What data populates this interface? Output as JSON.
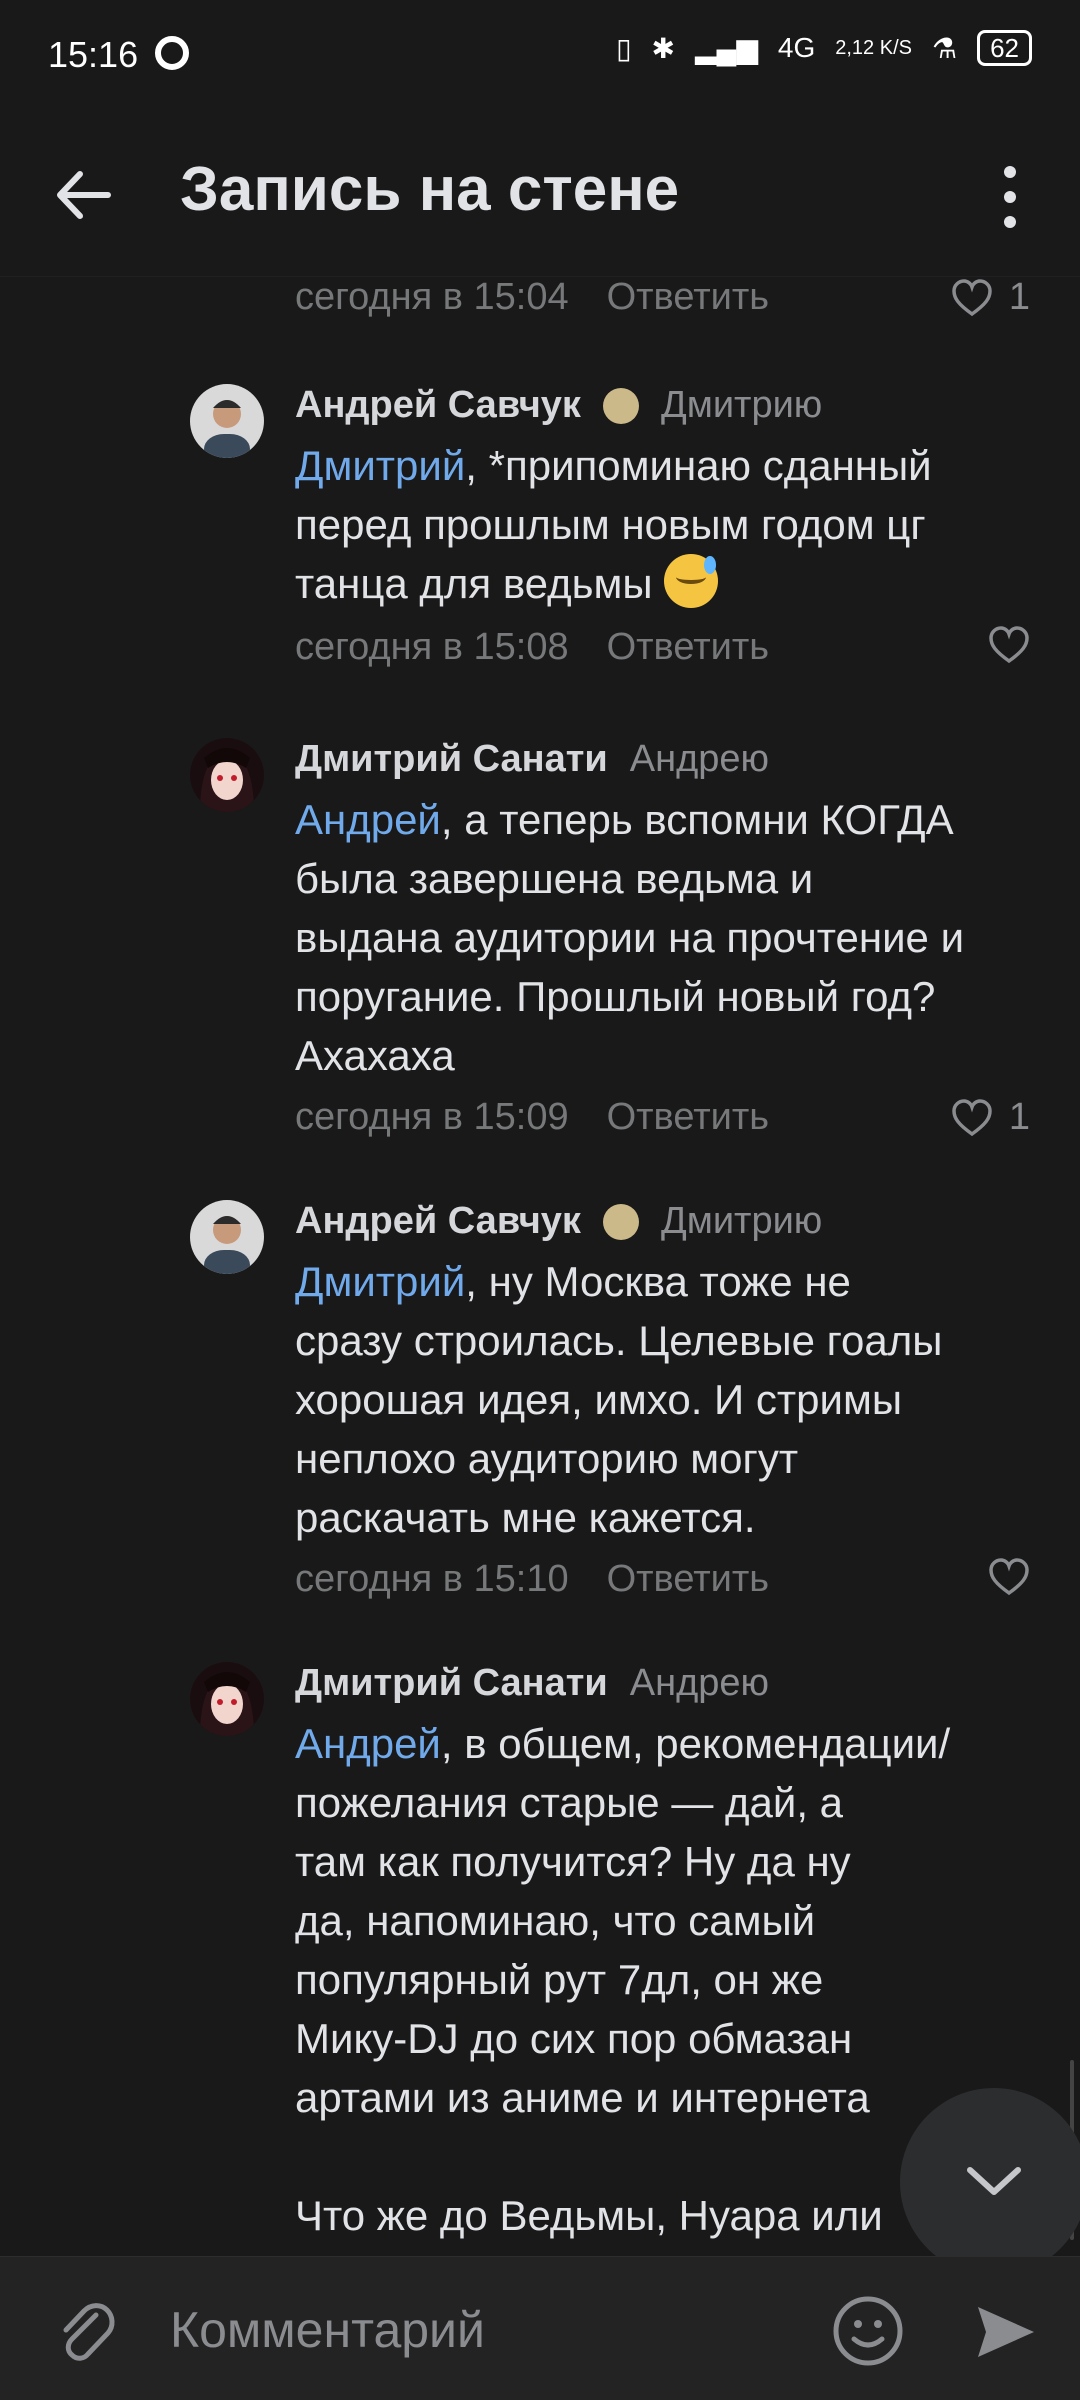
{
  "status": {
    "time": "15:16",
    "net": "4G",
    "speed": "2,12 K/S",
    "battery": "62"
  },
  "header": {
    "title": "Запись на стене"
  },
  "prev_comment": {
    "time": "сегодня в 15:04",
    "reply": "Ответить",
    "likes": "1"
  },
  "comments": [
    {
      "author": "Андрей Савчук",
      "to": "Дмитрию",
      "mention": "Дмитрий",
      "text": ", *припоминаю сданный\nперед прошлым новым годом цг\nтанца для ведьмы",
      "time": "сегодня в 15:08",
      "reply": "Ответить",
      "likes": ""
    },
    {
      "author": "Дмитрий Санати",
      "to": "Андрею",
      "mention": "Андрей",
      "text": ", а теперь вспомни КОГДА\nбыла завершена ведьма и\nвыдана аудитории на прочтение и\nпоругание. Прошлый новый год?\nАхахаха",
      "time": "сегодня в 15:09",
      "reply": "Ответить",
      "likes": "1"
    },
    {
      "author": "Андрей Савчук",
      "to": "Дмитрию",
      "mention": "Дмитрий",
      "text": ", ну Москва тоже не\nсразу строилась. Целевые гоалы\nхорошая идея, имхо. И стримы\nнеплохо аудиторию могут\nраскачать мне кажется.",
      "time": "сегодня в 15:10",
      "reply": "Ответить",
      "likes": ""
    },
    {
      "author": "Дмитрий Санати",
      "to": "Андрею",
      "mention": "Андрей",
      "text": ", в общем, рекомендации/\nпожелания старые — дай, а\nтам как получится? Ну да ну\nда, напоминаю, что самый\nпопулярный рут 7дл, он же\nМику-DJ до сих пор обмазан\nартами из аниме и интернета\n\nЧто же до Ведьмы, Нуара или",
      "time": "",
      "reply": "",
      "likes": ""
    }
  ],
  "composer": {
    "placeholder": "Комментарий"
  }
}
